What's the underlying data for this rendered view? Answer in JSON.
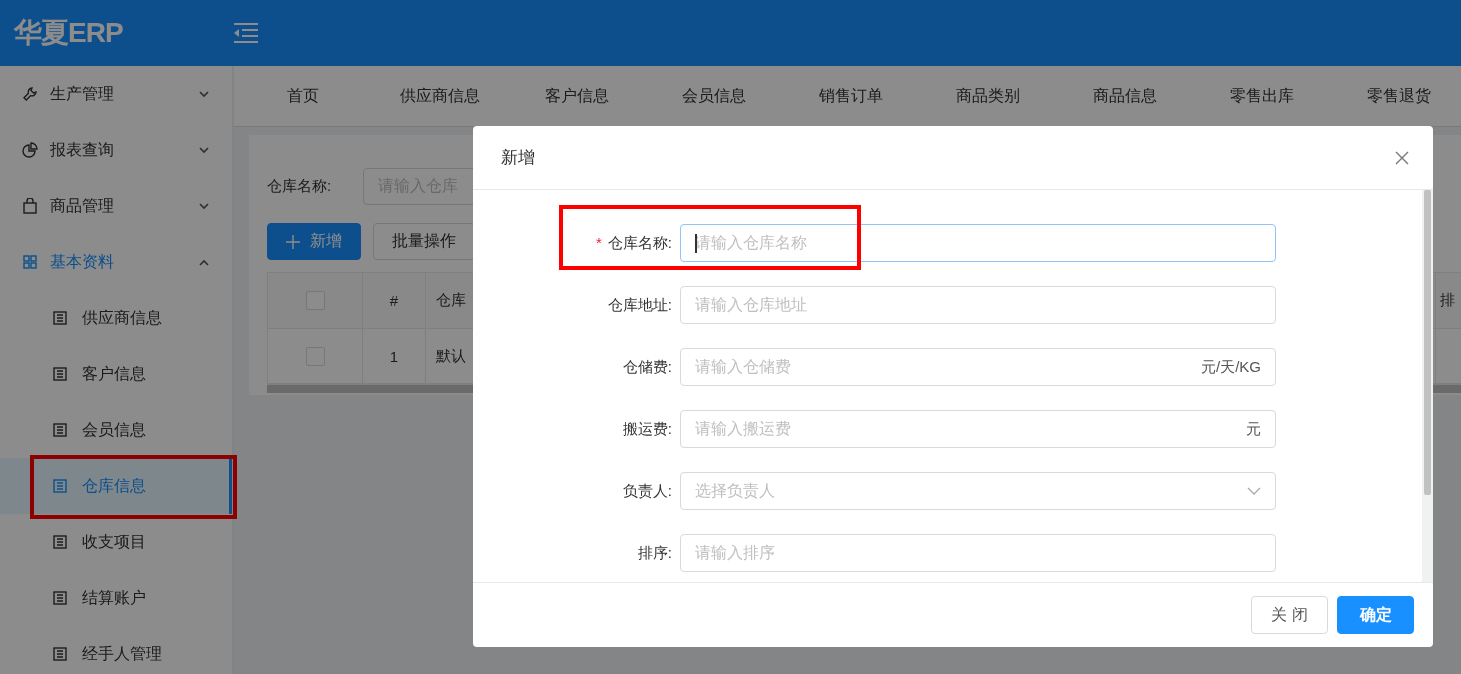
{
  "header": {
    "logo": "华夏ERP"
  },
  "sidebar": {
    "groups": [
      {
        "label": "生产管理",
        "expanded": false
      },
      {
        "label": "报表查询",
        "expanded": false
      },
      {
        "label": "商品管理",
        "expanded": false
      },
      {
        "label": "基本资料",
        "expanded": true,
        "children": [
          {
            "label": "供应商信息",
            "selected": false,
            "highlighted": false
          },
          {
            "label": "客户信息",
            "selected": false,
            "highlighted": false
          },
          {
            "label": "会员信息",
            "selected": false,
            "highlighted": false
          },
          {
            "label": "仓库信息",
            "selected": true,
            "highlighted": true
          },
          {
            "label": "收支项目",
            "selected": false,
            "highlighted": false
          },
          {
            "label": "结算账户",
            "selected": false,
            "highlighted": false
          },
          {
            "label": "经手人管理",
            "selected": false,
            "highlighted": false
          }
        ]
      }
    ]
  },
  "tabs": [
    {
      "label": "首页"
    },
    {
      "label": "供应商信息"
    },
    {
      "label": "客户信息"
    },
    {
      "label": "会员信息"
    },
    {
      "label": "销售订单"
    },
    {
      "label": "商品类别"
    },
    {
      "label": "商品信息"
    },
    {
      "label": "零售出库"
    },
    {
      "label": "零售退货"
    }
  ],
  "search": {
    "label": "仓库名称:",
    "placeholder": "请输入仓库"
  },
  "toolbar": [
    {
      "label": "新增",
      "kind": "primary"
    },
    {
      "label": "批量操作",
      "kind": "default"
    }
  ],
  "table": {
    "columns": [
      {
        "kind": "checkbox",
        "checked": false
      },
      {
        "kind": "text",
        "label": "#"
      },
      {
        "kind": "text",
        "label": "仓库"
      },
      {
        "kind": "text",
        "label": "排"
      }
    ],
    "rows": [
      {
        "checked": false,
        "cells": [
          "",
          "1",
          "默认",
          ""
        ]
      }
    ]
  },
  "modal": {
    "title": "新增",
    "fields": [
      {
        "label": "仓库名称:",
        "kind": "input",
        "placeholder": "请输入仓库名称",
        "required_mark": "*",
        "focused": true,
        "highlighted": true
      },
      {
        "label": "仓库地址:",
        "kind": "input",
        "placeholder": "请输入仓库地址",
        "focused": false,
        "highlighted": false
      },
      {
        "label": "仓储费:",
        "kind": "input",
        "placeholder": "请输入仓储费",
        "suffix": "元/天/KG",
        "focused": false,
        "highlighted": false
      },
      {
        "label": "搬运费:",
        "kind": "input",
        "placeholder": "请输入搬运费",
        "suffix": "元",
        "focused": false,
        "highlighted": false
      },
      {
        "label": "负责人:",
        "kind": "select",
        "placeholder": "选择负责人",
        "focused": false,
        "highlighted": false
      },
      {
        "label": "排序:",
        "kind": "input",
        "placeholder": "请输入排序",
        "focused": false,
        "highlighted": false
      }
    ],
    "buttons": [
      {
        "label": "关 闭",
        "kind": "default"
      },
      {
        "label": "确定",
        "kind": "primary"
      }
    ]
  }
}
